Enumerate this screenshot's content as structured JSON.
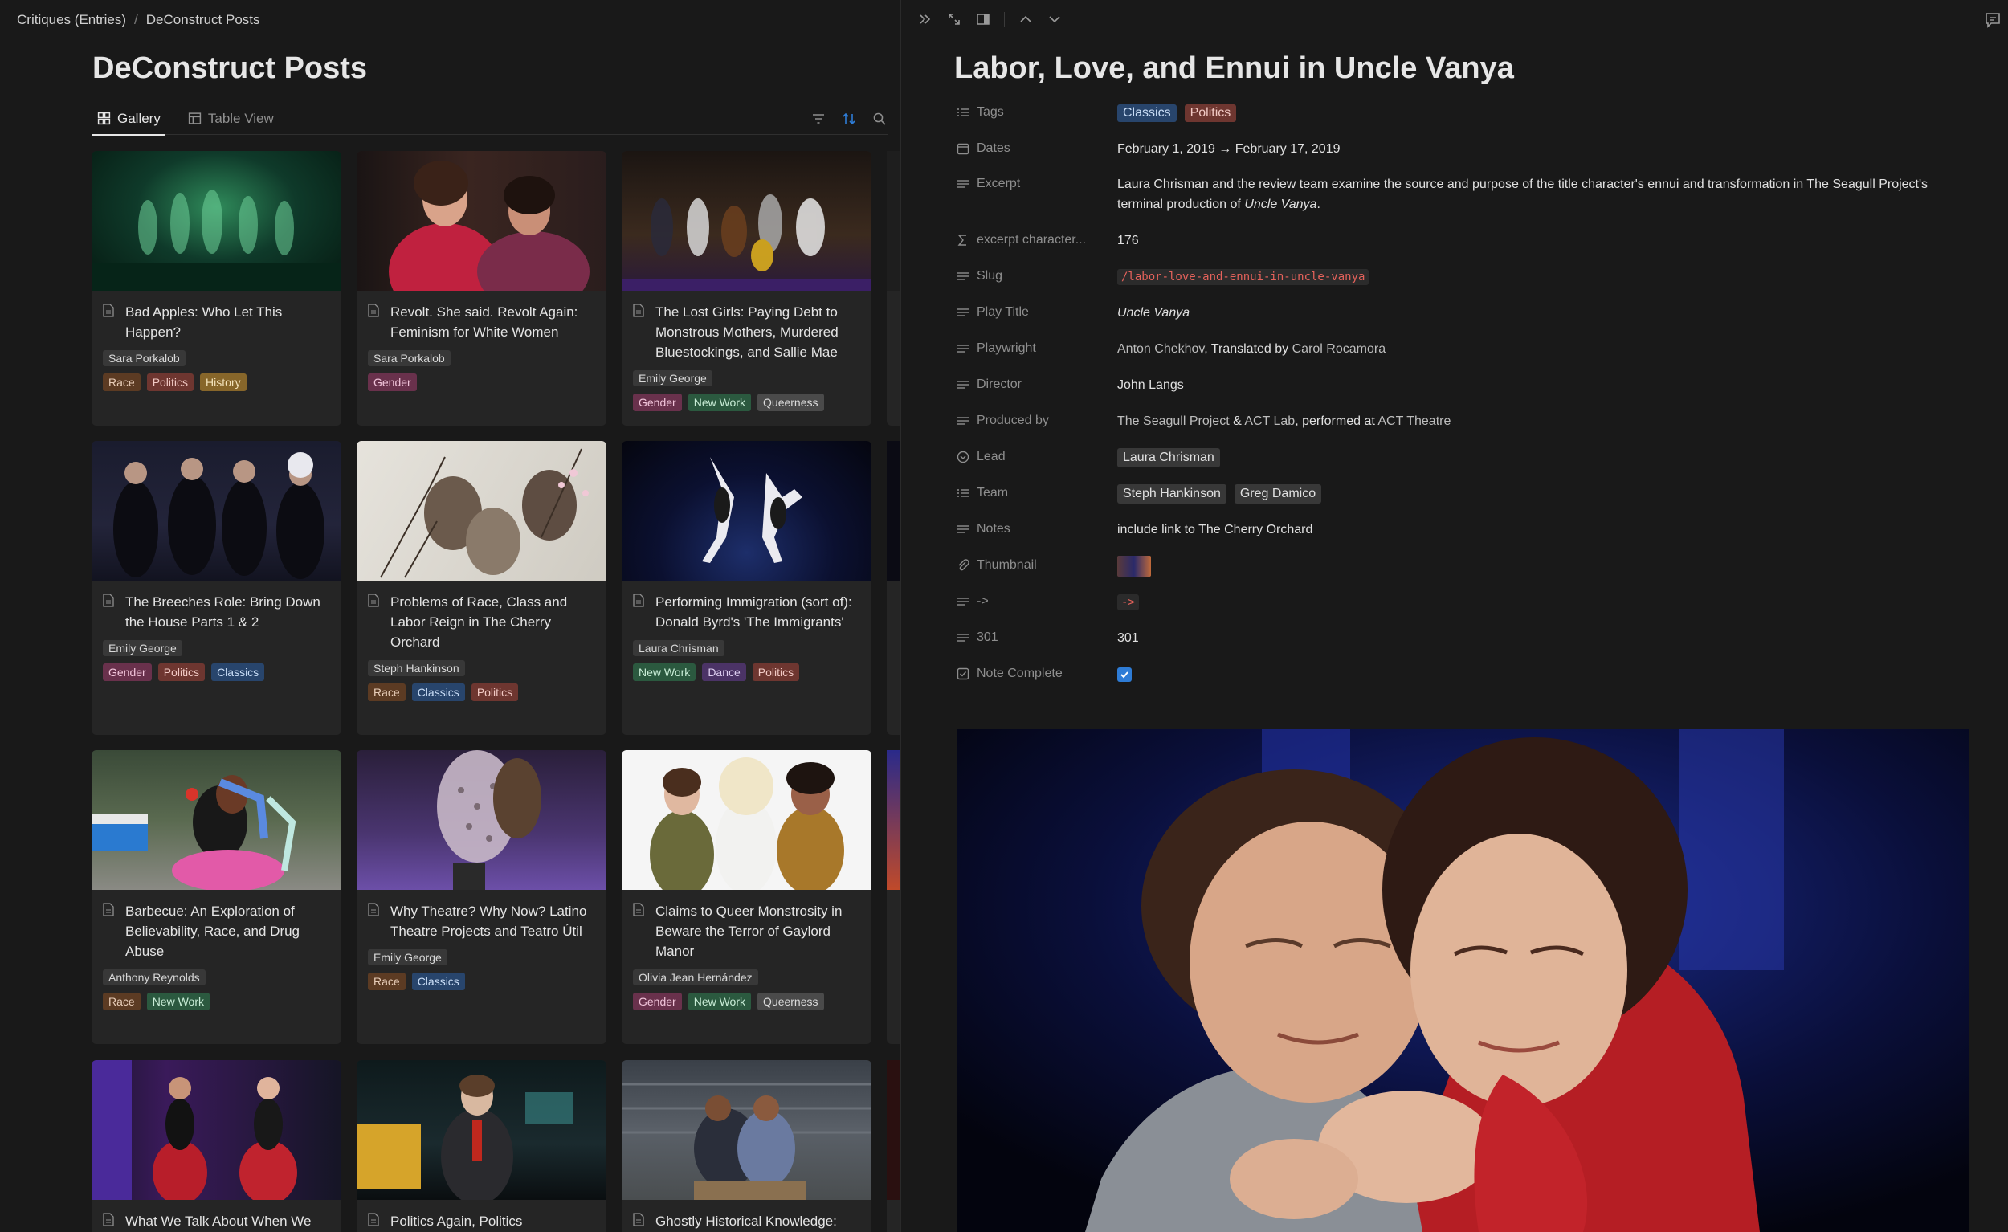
{
  "breadcrumb": {
    "parent": "Critiques (Entries)",
    "current": "DeConstruct Posts"
  },
  "database": {
    "title": "DeConstruct Posts",
    "tabs": [
      {
        "label": "Gallery"
      },
      {
        "label": "Table View"
      }
    ]
  },
  "cards": [
    {
      "title": "Bad Apples: Who Let This Happen?",
      "author": "Sara Porkalob",
      "tags": [
        "Race",
        "Politics",
        "History"
      ]
    },
    {
      "title": "Revolt. She said. Revolt Again: Feminism for White Women",
      "author": "Sara Porkalob",
      "tags": [
        "Gender"
      ]
    },
    {
      "title": "The Lost Girls: Paying Debt to Monstrous Mothers, Murdered Bluestockings, and Sallie Mae",
      "author": "Emily George",
      "tags": [
        "Gender",
        "New Work",
        "Queerness"
      ]
    },
    {
      "title": "The Breeches Role: Bring Down the House Parts 1 & 2",
      "author": "Emily George",
      "tags": [
        "Gender",
        "Politics",
        "Classics"
      ]
    },
    {
      "title": "Problems of Race, Class and Labor Reign in The Cherry Orchard",
      "author": "Steph Hankinson",
      "tags": [
        "Race",
        "Classics",
        "Politics"
      ]
    },
    {
      "title": "Performing Immigration (sort of): Donald Byrd's 'The Immigrants'",
      "author": "Laura Chrisman",
      "tags": [
        "New Work",
        "Dance",
        "Politics"
      ]
    },
    {
      "title": "Barbecue: An Exploration of Believability, Race, and Drug Abuse",
      "author": "Anthony Reynolds",
      "tags": [
        "Race",
        "New Work"
      ]
    },
    {
      "title": "Why Theatre? Why Now? Latino Theatre Projects and Teatro Útil",
      "author": "Emily George",
      "tags": [
        "Race",
        "Classics"
      ]
    },
    {
      "title": "Claims to Queer Monstrosity in Beware the Terror of Gaylord Manor",
      "author": "Olivia Jean Hernández",
      "tags": [
        "Gender",
        "New Work",
        "Queerness"
      ]
    },
    {
      "title": "What We Talk About When We",
      "author": "",
      "tags": []
    },
    {
      "title": "Politics Again, Politics",
      "author": "",
      "tags": []
    },
    {
      "title": "Ghostly Historical Knowledge:",
      "author": "",
      "tags": []
    }
  ],
  "tag_colors": {
    "Race": "#5c3b23",
    "Politics": "#6e3630",
    "History": "#87662a",
    "Gender": "#69314c",
    "New Work": "#2b593f",
    "Queerness": "#4a4a4a",
    "Classics": "#28456c",
    "Dance": "#4b3366"
  },
  "record": {
    "title": "Labor, Love, and Ennui in Uncle Vanya",
    "props": {
      "tags": {
        "label": "Tags",
        "values": [
          "Classics",
          "Politics"
        ]
      },
      "dates": {
        "label": "Dates",
        "value": "February 1, 2019 → February 17, 2019"
      },
      "excerpt": {
        "label": "Excerpt",
        "text_before": "Laura Chrisman and the review team examine the source and purpose of the title character's ennui and transformation in The Seagull Project's terminal production of ",
        "italic": "Uncle Vanya",
        "text_after": "."
      },
      "excerpt_count": {
        "label": "excerpt character...",
        "value": "176"
      },
      "slug": {
        "label": "Slug",
        "value": "/labor-love-and-ennui-in-uncle-vanya"
      },
      "play_title": {
        "label": "Play Title",
        "value": "Uncle Vanya"
      },
      "playwright": {
        "label": "Playwright",
        "author": "Anton Chekhov",
        "connector": ", Translated by ",
        "translator": "Carol Rocamora"
      },
      "director": {
        "label": "Director",
        "value": "John Langs"
      },
      "produced_by": {
        "label": "Produced by",
        "company1": "The Seagull Project",
        "amp": " & ",
        "company2": "ACT Lab",
        "connector": ", performed at ",
        "venue": "ACT Theatre"
      },
      "lead": {
        "label": "Lead",
        "value": "Laura Chrisman"
      },
      "team": {
        "label": "Team",
        "values": [
          "Steph Hankinson",
          "Greg Damico"
        ]
      },
      "notes": {
        "label": "Notes",
        "value": "include link to The Cherry Orchard"
      },
      "thumbnail": {
        "label": "Thumbnail"
      },
      "arrow": {
        "label": "->",
        "value": "->"
      },
      "code_301": {
        "label": "301",
        "value": "301"
      },
      "note_complete": {
        "label": "Note Complete",
        "checked": true
      }
    }
  },
  "colors": {
    "accent": "#2e7cd6",
    "background": "#191919",
    "card": "#252525",
    "slug": "#e5625b"
  }
}
